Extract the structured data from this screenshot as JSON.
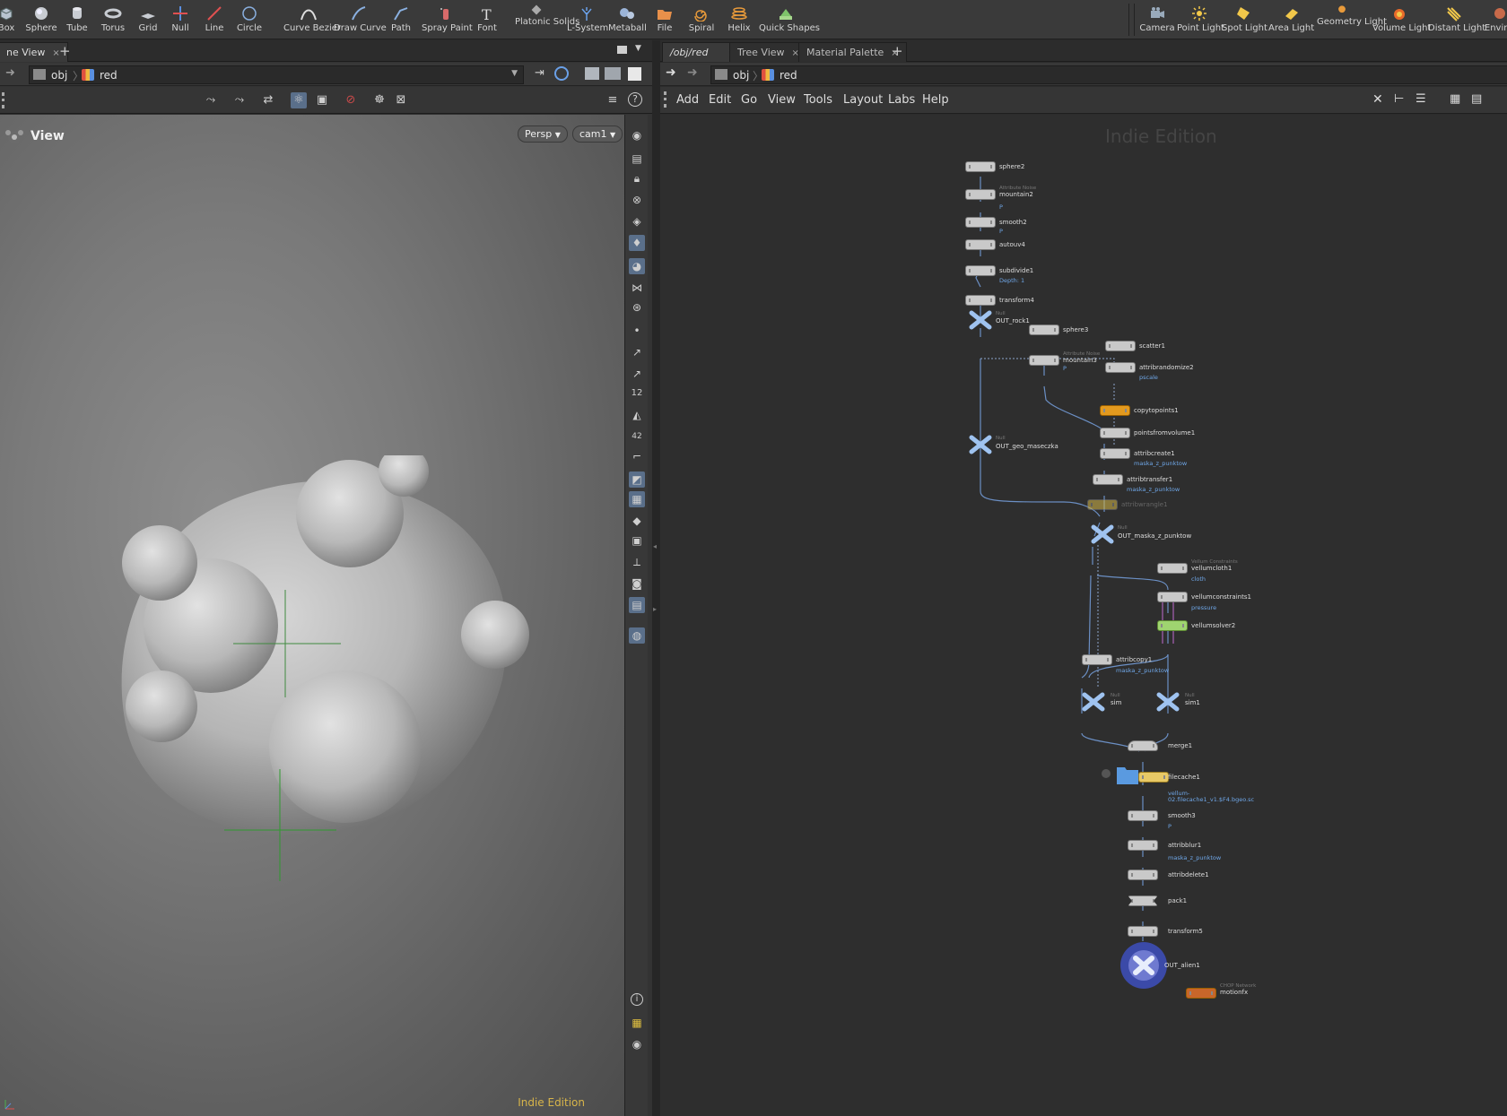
{
  "shelf": {
    "tools": [
      {
        "label": "Box",
        "icon": "box-icon"
      },
      {
        "label": "Sphere",
        "icon": "sphere-icon"
      },
      {
        "label": "Tube",
        "icon": "tube-icon"
      },
      {
        "label": "Torus",
        "icon": "torus-icon"
      },
      {
        "label": "Grid",
        "icon": "grid-icon"
      },
      {
        "label": "Null",
        "icon": "null-icon"
      },
      {
        "label": "Line",
        "icon": "line-icon"
      },
      {
        "label": "Circle",
        "icon": "circle-icon"
      },
      {
        "label": "Curve Bezier",
        "icon": "curve-bezier-icon"
      },
      {
        "label": "Draw Curve",
        "icon": "draw-curve-icon"
      },
      {
        "label": "Path",
        "icon": "path-icon"
      },
      {
        "label": "Spray Paint",
        "icon": "spray-paint-icon"
      },
      {
        "label": "Font",
        "icon": "font-icon"
      },
      {
        "label": "Platonic Solids",
        "icon": "platonic-solids-icon"
      },
      {
        "label": "L-System",
        "icon": "l-system-icon"
      },
      {
        "label": "Metaball",
        "icon": "metaball-icon"
      },
      {
        "label": "File",
        "icon": "file-icon"
      },
      {
        "label": "Spiral",
        "icon": "spiral-icon"
      },
      {
        "label": "Helix",
        "icon": "helix-icon"
      },
      {
        "label": "Quick Shapes",
        "icon": "quick-shapes-icon"
      }
    ],
    "lights": [
      {
        "label": "Camera",
        "icon": "camera-icon"
      },
      {
        "label": "Point Light",
        "icon": "point-light-icon"
      },
      {
        "label": "Spot Light",
        "icon": "spot-light-icon"
      },
      {
        "label": "Area Light",
        "icon": "area-light-icon"
      },
      {
        "label": "Geometry Light",
        "icon": "geometry-light-icon"
      },
      {
        "label": "Volume Light",
        "icon": "volume-light-icon"
      },
      {
        "label": "Distant Light",
        "icon": "distant-light-icon"
      },
      {
        "label": "Envir L",
        "icon": "environment-light-icon"
      }
    ]
  },
  "left": {
    "tab": "ne View",
    "path": {
      "root": "obj",
      "current": "red"
    },
    "viewport": {
      "title": "View",
      "projection": "Persp",
      "camera": "cam1",
      "watermark": "Indie Edition"
    }
  },
  "right": {
    "tabs": [
      {
        "label": "/obj/red"
      },
      {
        "label": "Tree View"
      },
      {
        "label": "Material Palette"
      }
    ],
    "path": {
      "root": "obj",
      "current": "red"
    },
    "menu": [
      "Add",
      "Edit",
      "Go",
      "View",
      "Tools",
      "Layout",
      "Labs",
      "Help"
    ],
    "watermark": "Indie Edition",
    "nodes": [
      {
        "name": "sphere2"
      },
      {
        "name": "mountain2",
        "type": "Attribute Noise",
        "sub": "P"
      },
      {
        "name": "smooth2",
        "sub": "P"
      },
      {
        "name": "autouv4"
      },
      {
        "name": "subdivide1",
        "sub": "Depth: 1"
      },
      {
        "name": "transform4"
      },
      {
        "name": "OUT_rock1",
        "type": "Null"
      },
      {
        "name": "sphere3"
      },
      {
        "name": "scatter1"
      },
      {
        "name": "mountain3",
        "type": "Attribute Noise",
        "sub": "P"
      },
      {
        "name": "attribrandomize2",
        "sub": "pscale"
      },
      {
        "name": "copytopoints1"
      },
      {
        "name": "pointsfromvolume1"
      },
      {
        "name": "OUT_geo_maseczka",
        "type": "Null"
      },
      {
        "name": "attribcreate1",
        "sub": "maska_z_punktow"
      },
      {
        "name": "attribtransfer1",
        "sub": "maska_z_punktow"
      },
      {
        "name": "attribwrangle1"
      },
      {
        "name": "OUT_maska_z_punktow",
        "type": "Null"
      },
      {
        "name": "vellumcloth1",
        "type": "Vellum Constraints",
        "sub": "cloth"
      },
      {
        "name": "vellumconstraints1",
        "sub": "pressure"
      },
      {
        "name": "vellumsolver2"
      },
      {
        "name": "attribcopy1",
        "sub": "maska_z_punktow"
      },
      {
        "name": "sim",
        "type": "Null"
      },
      {
        "name": "sim1",
        "type": "Null"
      },
      {
        "name": "merge1"
      },
      {
        "name": "filecache1",
        "sub": "vellum-02.filecache1_v1.$F4.bgeo.sc"
      },
      {
        "name": "smooth3",
        "sub": "P"
      },
      {
        "name": "attribblur1",
        "sub": "maska_z_punktow"
      },
      {
        "name": "attribdelete1"
      },
      {
        "name": "pack1"
      },
      {
        "name": "transform5"
      },
      {
        "name": "OUT_alien1"
      },
      {
        "name": "motionfx",
        "type": "CHOP Network"
      }
    ]
  }
}
